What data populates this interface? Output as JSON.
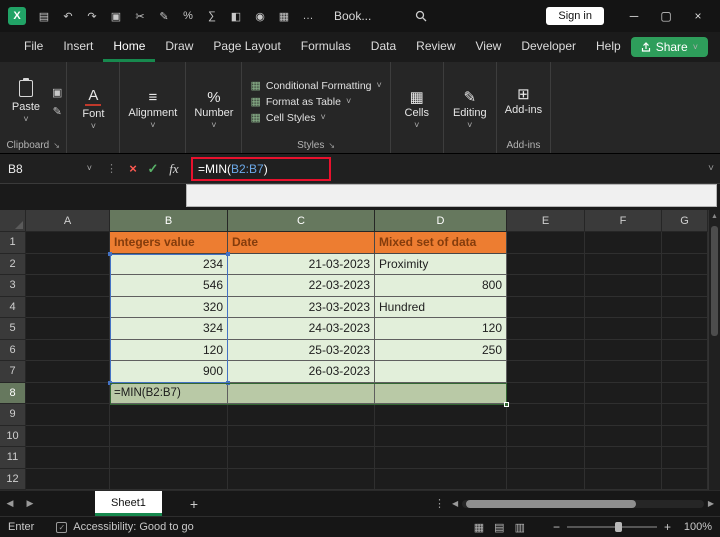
{
  "titlebar": {
    "title": "Book...",
    "sign_in_label": "Sign in",
    "qat": [
      {
        "name": "save-icon",
        "glyph": "▤"
      },
      {
        "name": "undo-icon",
        "glyph": "↶"
      },
      {
        "name": "redo-icon",
        "glyph": "↷"
      },
      {
        "name": "copy-icon",
        "glyph": "▣"
      },
      {
        "name": "cut-icon",
        "glyph": "✂"
      },
      {
        "name": "format-painter-icon",
        "glyph": "✎"
      },
      {
        "name": "percent-style-icon",
        "glyph": "%"
      },
      {
        "name": "autosum-icon",
        "glyph": "∑"
      },
      {
        "name": "fill-color-icon",
        "glyph": "◧"
      },
      {
        "name": "camera-icon",
        "glyph": "◉"
      },
      {
        "name": "table-icon",
        "glyph": "▦"
      },
      {
        "name": "more-commands-icon",
        "glyph": "…"
      }
    ],
    "window_controls": {
      "minimize": "─",
      "maximize": "▢",
      "close": "×"
    }
  },
  "menu": {
    "items": [
      "File",
      "Insert",
      "Home",
      "Draw",
      "Page Layout",
      "Formulas",
      "Data",
      "Review",
      "View",
      "Developer",
      "Help"
    ],
    "active": "Home",
    "share_label": "Share"
  },
  "glyphs": {
    "chevron": "˅",
    "launcher": "↘",
    "copy": "▣",
    "painter": "✎",
    "scroll_up": "▲"
  },
  "ribbon": {
    "paste_label": "Paste",
    "clipboard_caption": "Clipboard",
    "font": {
      "glyph": "A",
      "label": "Font"
    },
    "alignment": {
      "glyph": "≡",
      "label": "Alignment"
    },
    "number": {
      "glyph": "%",
      "label": "Number"
    },
    "styles": {
      "items": [
        {
          "glyph": "▦",
          "label": "Conditional Formatting"
        },
        {
          "glyph": "▦",
          "label": "Format as Table"
        },
        {
          "glyph": "▦",
          "label": "Cell Styles"
        }
      ],
      "caption": "Styles"
    },
    "cells": {
      "glyph": "▦",
      "label": "Cells"
    },
    "editing": {
      "glyph": "✎",
      "label": "Editing"
    },
    "addins": {
      "glyph": "⊞",
      "label": "Add-ins",
      "caption": "Add-ins"
    }
  },
  "formula_bar": {
    "name_box": "B8",
    "cancel_glyph": "×",
    "enter_glyph": "✓",
    "fx_label": "fx",
    "formula_pre": "=MIN(",
    "formula_ref": "B2:B7",
    "formula_post": ")"
  },
  "grid": {
    "col_headers": [
      "A",
      "B",
      "C",
      "D",
      "E",
      "F",
      "G"
    ],
    "row_headers": [
      "1",
      "2",
      "3",
      "4",
      "5",
      "6",
      "7",
      "8",
      "9",
      "10",
      "11",
      "12"
    ],
    "selected_cols": [
      "B",
      "C",
      "D"
    ],
    "selected_rows": [
      "8"
    ],
    "cells": [
      {
        "ref": "B1",
        "text": "Integers value",
        "kind": "h"
      },
      {
        "ref": "C1",
        "text": "Date",
        "kind": "h"
      },
      {
        "ref": "D1",
        "text": "Mixed set of data",
        "kind": "h"
      },
      {
        "ref": "B2",
        "text": "234",
        "kind": "n"
      },
      {
        "ref": "B3",
        "text": "546",
        "kind": "n"
      },
      {
        "ref": "B4",
        "text": "320",
        "kind": "n"
      },
      {
        "ref": "B5",
        "text": "324",
        "kind": "n"
      },
      {
        "ref": "B6",
        "text": "120",
        "kind": "n"
      },
      {
        "ref": "B7",
        "text": "900",
        "kind": "n"
      },
      {
        "ref": "C2",
        "text": "21-03-2023",
        "kind": "n"
      },
      {
        "ref": "C3",
        "text": "22-03-2023",
        "kind": "n"
      },
      {
        "ref": "C4",
        "text": "23-03-2023",
        "kind": "n"
      },
      {
        "ref": "C5",
        "text": "24-03-2023",
        "kind": "n"
      },
      {
        "ref": "C6",
        "text": "25-03-2023",
        "kind": "n"
      },
      {
        "ref": "C7",
        "text": "26-03-2023",
        "kind": "n"
      },
      {
        "ref": "D2",
        "text": "Proximity",
        "kind": "t"
      },
      {
        "ref": "D3",
        "text": "800",
        "kind": "n"
      },
      {
        "ref": "D4",
        "text": "Hundred",
        "kind": "t"
      },
      {
        "ref": "D5",
        "text": "120",
        "kind": "n"
      },
      {
        "ref": "D6",
        "text": "250",
        "kind": "n"
      },
      {
        "ref": "D7",
        "text": "",
        "kind": "e"
      },
      {
        "ref": "B8",
        "text": "=MIN(B2:B7)",
        "kind": "f"
      },
      {
        "ref": "C8",
        "text": "",
        "kind": "s"
      },
      {
        "ref": "D8",
        "text": "",
        "kind": "s"
      }
    ]
  },
  "tabbar": {
    "sheet_label": "Sheet1",
    "add_glyph": "+",
    "kebab_glyph": "⋮",
    "left_glyph": "◀",
    "right_glyph": "▶"
  },
  "statusbar": {
    "mode": "Enter",
    "accessibility_glyph": "✓",
    "accessibility_label": "Accessibility: Good to go",
    "view_glyphs": [
      "▦",
      "▤",
      "▥"
    ],
    "zoom_out": "−",
    "zoom_in": "+",
    "zoom_label": "100%"
  },
  "colors": {
    "excel_green": "#21A366",
    "share_green": "#2E9E5B",
    "tab_underline_green": "#17894E",
    "header_fill": "#ED7D31",
    "header_text": "#843C0C",
    "cell_fill": "#E2EFDA",
    "selection_fill": "#B9C9A6",
    "selection_border": "#336633",
    "range_border": "#4472C4",
    "annotation_red": "#E8112D",
    "formula_ref_blue": "#6CA9E8"
  }
}
